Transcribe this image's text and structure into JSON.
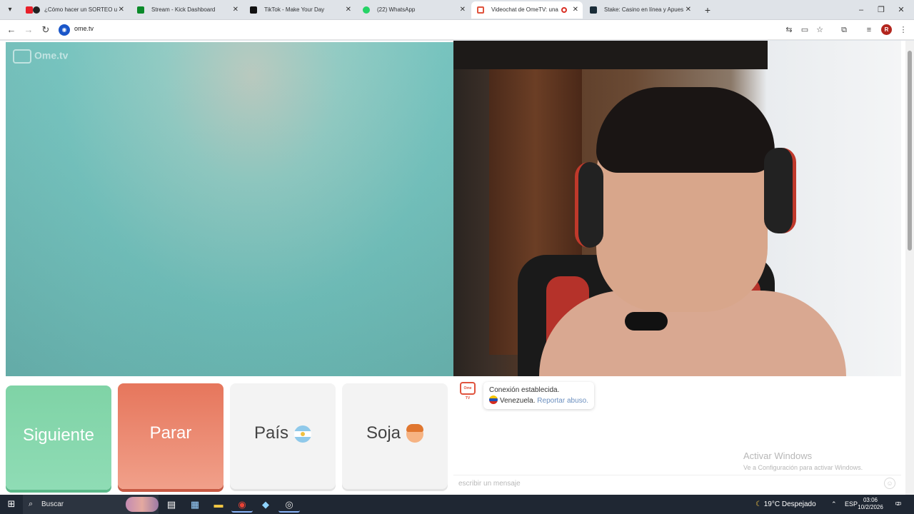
{
  "browser": {
    "tabs": [
      {
        "title": "¿Cómo hacer un SORTEO u",
        "favicon_color": "#d4145a",
        "active": false
      },
      {
        "title": "Stream - Kick Dashboard",
        "favicon_color": "#0b8a2a",
        "active": false
      },
      {
        "title": "TikTok - Make Your Day",
        "favicon_color": "#111111",
        "active": false
      },
      {
        "title": "(22) WhatsApp",
        "favicon_color": "#25d366",
        "active": false
      },
      {
        "title": "Videochat de OmeTV: una",
        "favicon_color": "#e0533d",
        "active": true
      },
      {
        "title": "Stake: Casino en línea y Apues",
        "favicon_color": "#1a2c38",
        "active": false
      }
    ],
    "url": "ome.tv",
    "profile_initial": "R"
  },
  "page": {
    "watermark": "Ome.tv",
    "buttons": {
      "next": "Siguiente",
      "stop": "Parar",
      "country": "País",
      "gender": "Soja"
    },
    "chat": {
      "logo_text": "Ome TV",
      "status": "Conexión establecida.",
      "country": "Venezuela.",
      "report": "Reportar abuso.",
      "placeholder": "escribir un mensaje"
    },
    "activate_windows": {
      "title": "Activar Windows",
      "subtitle": "Ve a Configuración para activar Windows."
    }
  },
  "taskbar": {
    "search": "Buscar",
    "weather": "19°C  Despejado",
    "language": "ESP",
    "time": "03:06",
    "date": "10/2/2026",
    "notifications": "2"
  }
}
